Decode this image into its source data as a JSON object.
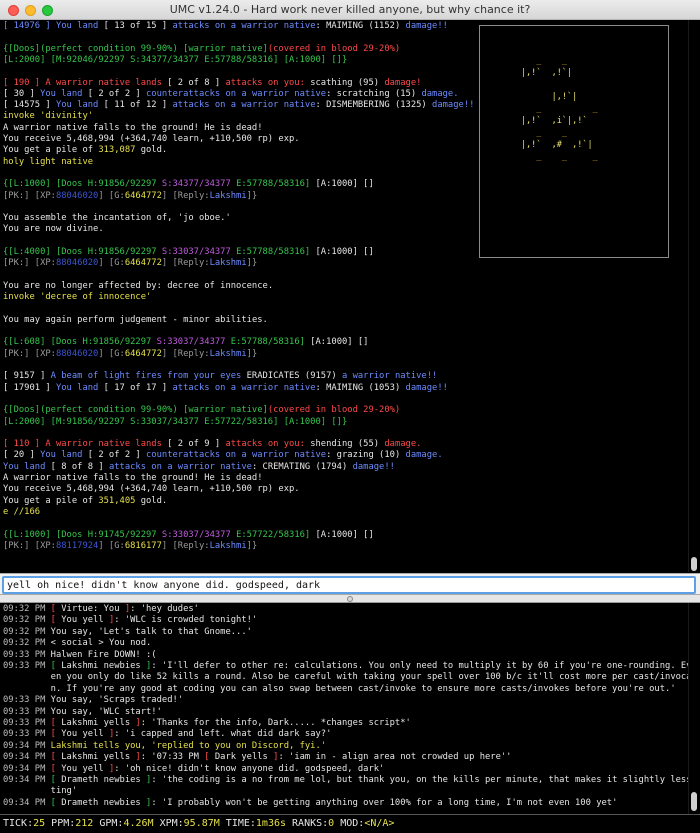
{
  "window": {
    "title": "UMC v1.24.0 - Hard work never killed anyone, but why chance it?"
  },
  "colors": {
    "green": "#36c54d",
    "blue": "#6c8cff",
    "red": "#ff4a4a",
    "yellow": "#e5e04a",
    "input_border": "#5da0e6"
  },
  "map": {
    "rows": [
      "           _    _",
      "        |,!`  ,!`|",
      "",
      "              |,!`|",
      "           _          _",
      "        |,!`  ,i`|,!`",
      "           _    _",
      "        |,!`  ,#  ,!`|",
      "           _    _     _"
    ]
  },
  "output": {
    "lines": [
      [
        {
          "t": "[ 14976 ] ",
          "c": "b"
        },
        {
          "t": "You land ",
          "c": "b"
        },
        {
          "t": "[ 13 of 15 ] ",
          "c": "w"
        },
        {
          "t": "attacks on a warrior native",
          "c": "b"
        },
        {
          "t": ": MAIMING (1152) ",
          "c": "w"
        },
        {
          "t": "damage!!",
          "c": "b"
        }
      ],
      [],
      [
        {
          "t": "{[Doos]",
          "c": "g"
        },
        {
          "t": "(perfect condition 99-90%) ",
          "c": "g"
        },
        {
          "t": "[warrior native]",
          "c": "g"
        },
        {
          "t": "(covered in blood 29-20%)",
          "c": "r"
        }
      ],
      [
        {
          "t": "[L:2000] [M:92046/92297 S:34377/34377 E:57788/58316] [A:1000] []}",
          "c": "g"
        }
      ],
      [],
      [
        {
          "t": "[ 190 ] ",
          "c": "r"
        },
        {
          "t": "A warrior native lands ",
          "c": "r"
        },
        {
          "t": "[ 2 of 8 ] ",
          "c": "w"
        },
        {
          "t": "attacks on you: ",
          "c": "r"
        },
        {
          "t": "scathing (95) ",
          "c": "w"
        },
        {
          "t": "damage!",
          "c": "r"
        }
      ],
      [
        {
          "t": "[ 30 ] ",
          "c": "w"
        },
        {
          "t": "You land ",
          "c": "b"
        },
        {
          "t": "[ 2 of 2 ] ",
          "c": "w"
        },
        {
          "t": "counterattacks on a warrior native",
          "c": "b"
        },
        {
          "t": ": scratching (15) ",
          "c": "w"
        },
        {
          "t": "damage.",
          "c": "b"
        }
      ],
      [
        {
          "t": "[ 14575 ] ",
          "c": "w"
        },
        {
          "t": "You land ",
          "c": "b"
        },
        {
          "t": "[ 11 of 12 ] ",
          "c": "w"
        },
        {
          "t": "attacks on a warrior native",
          "c": "b"
        },
        {
          "t": ": DISMEMBERING (1325) ",
          "c": "w"
        },
        {
          "t": "damage!!",
          "c": "b"
        }
      ],
      [
        {
          "t": "invoke 'divinity'",
          "c": "y"
        }
      ],
      [
        {
          "t": "A warrior native falls to the ground! He is dead!",
          "c": "w"
        }
      ],
      [
        {
          "t": "You receive 5,468,994 (+364,740 learn, +110,500 rp) exp.",
          "c": "w"
        }
      ],
      [
        {
          "t": "You get a pile of ",
          "c": "w"
        },
        {
          "t": "313,087",
          "c": "y"
        },
        {
          "t": " gold.",
          "c": "w"
        }
      ],
      [
        {
          "t": "holy light native",
          "c": "y"
        }
      ],
      [],
      [
        {
          "t": "{[L:1000] [Doos ",
          "c": "g"
        },
        {
          "t": "H:91856/92297 ",
          "c": "g"
        },
        {
          "t": "S:34377/34377 ",
          "c": "m"
        },
        {
          "t": "E:57788/58316] ",
          "c": "g"
        },
        {
          "t": "[A:1000] []",
          "c": "w"
        }
      ],
      [
        {
          "t": "[PK:] [XP:",
          "c": "gr"
        },
        {
          "t": "88046020",
          "c": "db"
        },
        {
          "t": "] [G:",
          "c": "gr"
        },
        {
          "t": "6464772",
          "c": "y"
        },
        {
          "t": "] [Reply:",
          "c": "gr"
        },
        {
          "t": "Lakshmi",
          "c": "b"
        },
        {
          "t": "]}",
          "c": "gr"
        }
      ],
      [],
      [
        {
          "t": "You assemble the incantation of, 'jo oboe.'",
          "c": "w"
        }
      ],
      [
        {
          "t": "You are now divine.",
          "c": "w"
        }
      ],
      [],
      [
        {
          "t": "{[L:4000] [Doos ",
          "c": "g"
        },
        {
          "t": "H:91856/92297 ",
          "c": "g"
        },
        {
          "t": "S:33037/34377 ",
          "c": "m"
        },
        {
          "t": "E:57788/58316] ",
          "c": "g"
        },
        {
          "t": "[A:1000] []",
          "c": "w"
        }
      ],
      [
        {
          "t": "[PK:] [XP:",
          "c": "gr"
        },
        {
          "t": "88046020",
          "c": "db"
        },
        {
          "t": "] [G:",
          "c": "gr"
        },
        {
          "t": "6464772",
          "c": "y"
        },
        {
          "t": "] [Reply:",
          "c": "gr"
        },
        {
          "t": "Lakshmi",
          "c": "b"
        },
        {
          "t": "]}",
          "c": "gr"
        }
      ],
      [],
      [
        {
          "t": "You are no longer affected by: ",
          "c": "w"
        },
        {
          "t": "decree of innocence.",
          "c": "w"
        }
      ],
      [
        {
          "t": "invoke 'decree of innocence'",
          "c": "y"
        }
      ],
      [],
      [
        {
          "t": "You may again perform ",
          "c": "w"
        },
        {
          "t": "judgement - minor",
          "c": "w"
        },
        {
          "t": " abilities.",
          "c": "w"
        }
      ],
      [],
      [
        {
          "t": "{[L:608] [Doos ",
          "c": "g"
        },
        {
          "t": "H:91856/92297 ",
          "c": "g"
        },
        {
          "t": "S:33037/34377 ",
          "c": "m"
        },
        {
          "t": "E:57788/58316] ",
          "c": "g"
        },
        {
          "t": "[A:1000] []",
          "c": "w"
        }
      ],
      [
        {
          "t": "[PK:] [XP:",
          "c": "gr"
        },
        {
          "t": "88046020",
          "c": "db"
        },
        {
          "t": "] [G:",
          "c": "gr"
        },
        {
          "t": "6464772",
          "c": "y"
        },
        {
          "t": "] [Reply:",
          "c": "gr"
        },
        {
          "t": "Lakshmi",
          "c": "b"
        },
        {
          "t": "]}",
          "c": "gr"
        }
      ],
      [],
      [
        {
          "t": "[ 9157 ] ",
          "c": "w"
        },
        {
          "t": "A beam of light fires from your eyes ",
          "c": "b"
        },
        {
          "t": "ERADICATES (9157) ",
          "c": "w"
        },
        {
          "t": "a warrior native!!",
          "c": "b"
        }
      ],
      [
        {
          "t": "[ 17901 ] ",
          "c": "w"
        },
        {
          "t": "You land ",
          "c": "b"
        },
        {
          "t": "[ 17 of 17 ] ",
          "c": "w"
        },
        {
          "t": "attacks on a warrior native",
          "c": "b"
        },
        {
          "t": ": MAIMING (1053) ",
          "c": "w"
        },
        {
          "t": "damage!!",
          "c": "b"
        }
      ],
      [],
      [
        {
          "t": "{[Doos]",
          "c": "g"
        },
        {
          "t": "(perfect condition 99-90%) ",
          "c": "g"
        },
        {
          "t": "[warrior native]",
          "c": "g"
        },
        {
          "t": "(covered in blood 29-20%)",
          "c": "r"
        }
      ],
      [
        {
          "t": "[L:2000] [M:91856/92297 S:33037/34377 E:57722/58316] [A:1000] []}",
          "c": "g"
        }
      ],
      [],
      [
        {
          "t": "[ 110 ] ",
          "c": "r"
        },
        {
          "t": "A warrior native lands ",
          "c": "r"
        },
        {
          "t": "[ 2 of 9 ] ",
          "c": "w"
        },
        {
          "t": "attacks on you: ",
          "c": "r"
        },
        {
          "t": "shending (55) ",
          "c": "w"
        },
        {
          "t": "damage.",
          "c": "r"
        }
      ],
      [
        {
          "t": "[ 20 ] ",
          "c": "w"
        },
        {
          "t": "You land ",
          "c": "b"
        },
        {
          "t": "[ 2 of 2 ] ",
          "c": "w"
        },
        {
          "t": "counterattacks on a warrior native",
          "c": "b"
        },
        {
          "t": ": grazing (10) ",
          "c": "w"
        },
        {
          "t": "damage.",
          "c": "b"
        }
      ],
      [
        {
          "t": "You land ",
          "c": "b"
        },
        {
          "t": "[ 8 of 8 ] ",
          "c": "w"
        },
        {
          "t": "attacks on a warrior native",
          "c": "b"
        },
        {
          "t": ": CREMATING (1794) ",
          "c": "w"
        },
        {
          "t": "damage!!",
          "c": "b"
        }
      ],
      [
        {
          "t": "A warrior native falls to the ground! He is dead!",
          "c": "w"
        }
      ],
      [
        {
          "t": "You receive 5,468,994 (+364,740 learn, +110,500 rp) exp.",
          "c": "w"
        }
      ],
      [
        {
          "t": "You get a pile of ",
          "c": "w"
        },
        {
          "t": "351,405",
          "c": "y"
        },
        {
          "t": " gold.",
          "c": "w"
        }
      ],
      [
        {
          "t": "e //166",
          "c": "y"
        }
      ],
      [],
      [
        {
          "t": "{[L:1000] [Doos ",
          "c": "g"
        },
        {
          "t": "H:91745/92297 ",
          "c": "g"
        },
        {
          "t": "S:33037/34377 ",
          "c": "m"
        },
        {
          "t": "E:57722/58316] ",
          "c": "g"
        },
        {
          "t": "[A:1000] []",
          "c": "w"
        }
      ],
      [
        {
          "t": "[PK:] [XP:",
          "c": "gr"
        },
        {
          "t": "88117924",
          "c": "db"
        },
        {
          "t": "] [G:",
          "c": "gr"
        },
        {
          "t": "6816177",
          "c": "y"
        },
        {
          "t": "] [Reply:",
          "c": "gr"
        },
        {
          "t": "Lakshmi",
          "c": "b"
        },
        {
          "t": "]}",
          "c": "gr"
        }
      ]
    ]
  },
  "input": {
    "value": "yell oh nice! didn't know anyone did. godspeed, dark"
  },
  "chat": {
    "lines": [
      [
        {
          "t": "09:32 PM ",
          "c": "lg"
        },
        {
          "t": "[ ",
          "c": "r"
        },
        {
          "t": "Virtue",
          "c": "w"
        },
        {
          "t": ": You ",
          "c": "w"
        },
        {
          "t": "]",
          "c": "r"
        },
        {
          "t": ": 'hey dudes'",
          "c": "w"
        }
      ],
      [
        {
          "t": "09:32 PM ",
          "c": "lg"
        },
        {
          "t": "[ ",
          "c": "r"
        },
        {
          "t": "You yell ",
          "c": "w"
        },
        {
          "t": "]",
          "c": "r"
        },
        {
          "t": ": 'WLC is crowded tonight!'",
          "c": "w"
        }
      ],
      [
        {
          "t": "09:32 PM ",
          "c": "lg"
        },
        {
          "t": "You say, 'Let's talk to that Gnome...'",
          "c": "w"
        }
      ],
      [
        {
          "t": "09:32 PM ",
          "c": "lg"
        },
        {
          "t": "< social > ",
          "c": "w"
        },
        {
          "t": "You nod.",
          "c": "w"
        }
      ],
      [
        {
          "t": "09:33 PM ",
          "c": "lg"
        },
        {
          "t": "Halwen Fire DOWN! :(",
          "c": "w"
        }
      ],
      [
        {
          "t": "09:33 PM ",
          "c": "lg"
        },
        {
          "t": "[ ",
          "c": "g"
        },
        {
          "t": "Lakshmi newbies ",
          "c": "w"
        },
        {
          "t": "]",
          "c": "g"
        },
        {
          "t": ": 'I'll defer to other re: calculations. You only need to multiply it by 60 if you're one-rounding. Even th",
          "c": "w"
        }
      ],
      [
        {
          "t": "         en you only do like 52 kills a round. Also be careful with taking your spell over 100 b/c it'll cost more per cast/invocatio",
          "c": "w"
        }
      ],
      [
        {
          "t": "         n. If you're any good at coding you can also swap between cast/invoke to ensure more casts/invokes before you're out.'",
          "c": "w"
        }
      ],
      [
        {
          "t": "09:33 PM ",
          "c": "lg"
        },
        {
          "t": "You say, 'Scraps traded!'",
          "c": "w"
        }
      ],
      [
        {
          "t": "09:33 PM ",
          "c": "lg"
        },
        {
          "t": "You say, 'WLC start!'",
          "c": "w"
        }
      ],
      [
        {
          "t": "09:33 PM ",
          "c": "lg"
        },
        {
          "t": "[ ",
          "c": "r"
        },
        {
          "t": "Lakshmi yells ",
          "c": "w"
        },
        {
          "t": "]",
          "c": "r"
        },
        {
          "t": ": 'Thanks for the info, Dark..... *changes script*'",
          "c": "w"
        }
      ],
      [
        {
          "t": "09:33 PM ",
          "c": "lg"
        },
        {
          "t": "[ ",
          "c": "r"
        },
        {
          "t": "You yell ",
          "c": "w"
        },
        {
          "t": "]",
          "c": "r"
        },
        {
          "t": ": 'i capped and left. what did dark say?'",
          "c": "w"
        }
      ],
      [
        {
          "t": "09:34 PM ",
          "c": "lg"
        },
        {
          "t": "Lakshmi tells you, 'replied to you on Discord, fyi.'",
          "c": "y"
        }
      ],
      [
        {
          "t": "09:34 PM ",
          "c": "lg"
        },
        {
          "t": "[ ",
          "c": "r"
        },
        {
          "t": "Lakshmi yells ",
          "c": "w"
        },
        {
          "t": "]",
          "c": "r"
        },
        {
          "t": ": '07:33 PM ",
          "c": "w"
        },
        {
          "t": "[ ",
          "c": "r"
        },
        {
          "t": "Dark yells ",
          "c": "w"
        },
        {
          "t": "]",
          "c": "r"
        },
        {
          "t": ": 'iam in - align area not crowded up here''",
          "c": "w"
        }
      ],
      [
        {
          "t": "09:34 PM ",
          "c": "lg"
        },
        {
          "t": "[ ",
          "c": "r"
        },
        {
          "t": "You yell ",
          "c": "w"
        },
        {
          "t": "]",
          "c": "r"
        },
        {
          "t": ": 'oh nice! didn't know anyone did. godspeed, dark'",
          "c": "w"
        }
      ],
      [
        {
          "t": "09:34 PM ",
          "c": "lg"
        },
        {
          "t": "[ ",
          "c": "g"
        },
        {
          "t": "Drameth newbies ",
          "c": "w"
        },
        {
          "t": "]",
          "c": "g"
        },
        {
          "t": ": 'the coding is a no from me lol, but thank you, on the kills per minute, that makes it slightly less daun",
          "c": "w"
        }
      ],
      [
        {
          "t": "         ting'",
          "c": "w"
        }
      ],
      [
        {
          "t": "09:34 PM ",
          "c": "lg"
        },
        {
          "t": "[ ",
          "c": "g"
        },
        {
          "t": "Drameth newbies ",
          "c": "w"
        },
        {
          "t": "]",
          "c": "g"
        },
        {
          "t": ": 'I probably won't be getting anything over 100% for a long time, I'm not even 100 yet'",
          "c": "w"
        }
      ]
    ]
  },
  "status": {
    "segments": [
      {
        "t": "TICK:",
        "c": "w"
      },
      {
        "t": "25",
        "c": "y"
      },
      {
        "t": " PPM:",
        "c": "w"
      },
      {
        "t": "212",
        "c": "y"
      },
      {
        "t": " GPM:",
        "c": "w"
      },
      {
        "t": "4.26M",
        "c": "y"
      },
      {
        "t": " XPM:",
        "c": "w"
      },
      {
        "t": "95.87M",
        "c": "y"
      },
      {
        "t": " TIME:",
        "c": "w"
      },
      {
        "t": "1m36s",
        "c": "y"
      },
      {
        "t": " RANKS:",
        "c": "w"
      },
      {
        "t": "0",
        "c": "y"
      },
      {
        "t": " MOD:",
        "c": "w"
      },
      {
        "t": "<N/A>",
        "c": "y"
      }
    ]
  }
}
